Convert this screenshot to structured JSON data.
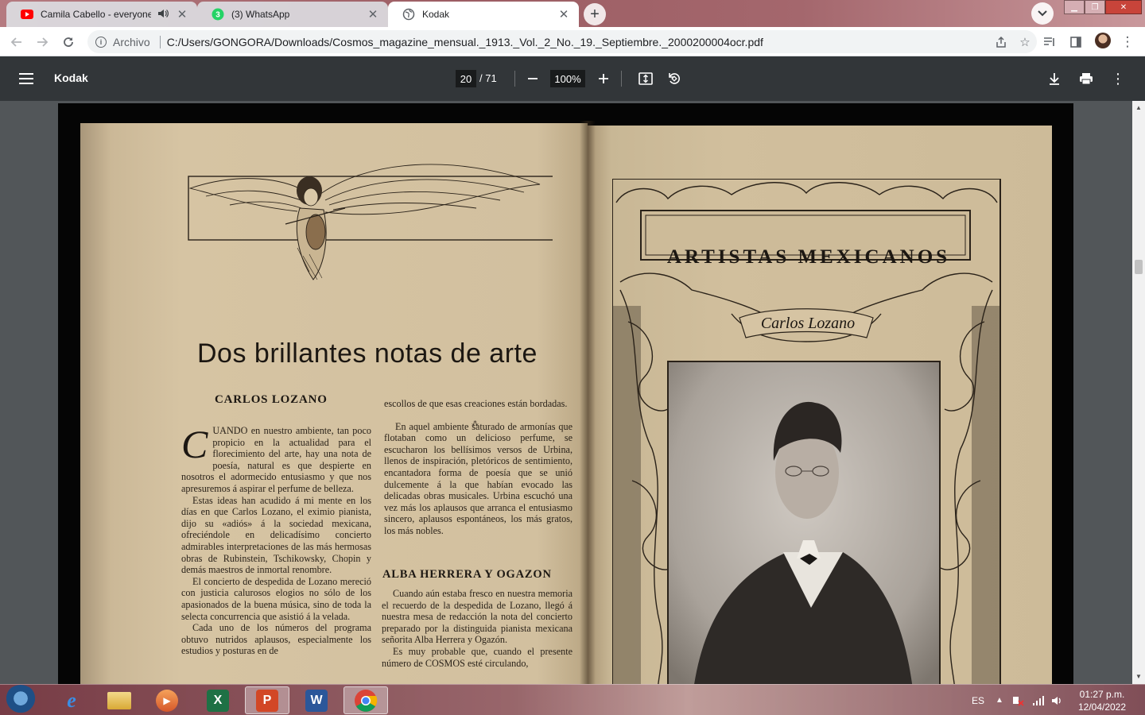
{
  "browser": {
    "tabs": [
      {
        "title": "Camila Cabello - everyone at",
        "favicon": "youtube-icon",
        "audio": true
      },
      {
        "title": "(3) WhatsApp",
        "favicon": "whatsapp-icon",
        "badge": "3"
      },
      {
        "title": "Kodak",
        "favicon": "globe-icon",
        "active": true
      }
    ],
    "scheme_label": "Archivo",
    "url": "C:/Users/GONGORA/Downloads/Cosmos_magazine_mensual._1913._Vol._2_No._19._Septiembre._2000200004ocr.pdf"
  },
  "pdf": {
    "title": "Kodak",
    "page_current": "20",
    "page_total": "/ 71",
    "zoom": "100%"
  },
  "magazine": {
    "left_title": "Dos brillantes notas de arte",
    "heading1": "CARLOS LOZANO",
    "dropcap": "C",
    "col1_p1": "UANDO en nuestro ambiente, tan poco propicio en la actualidad para el florecimiento del arte, hay una nota de poesía, natural es que despierte en nosotros el adormecido entusiasmo y que nos apresuremos á aspirar el perfume de belleza.",
    "col1_p2": "Estas ideas han acudido á mi mente en los días en que Carlos Lozano, el eximio pianista, dijo su «adiós» á la sociedad mexicana, ofreciéndole en delicadísimo concierto admirables interpretaciones de las más hermosas obras de Rubinstein, Tschikowsky, Chopin y demás maestros de inmortal renombre.",
    "col1_p3": "El concierto de despedida de Lozano mereció con justicia calurosos elogios no sólo de los apasionados de la buena música, sino de toda la selecta concurrencia que asistió á la velada.",
    "col1_p4": "Cada uno de los números del programa obtuvo nutridos aplausos, especialmente los estudios y posturas en de",
    "col2_p1": "escollos de que esas creaciones están bordadas.",
    "col2_p2": "En aquel ambiente saturado de armonías que flotaban como un delicioso perfume, se escucharon los bellísimos versos de Urbina, llenos de inspiración, pletóricos de sentimiento, encantadora forma de poesía que se unió dulcemente á la que habían evocado las delicadas obras musicales. Urbina escuchó una vez más los aplausos que arranca el entusiasmo sincero, aplausos espontáneos, los más gratos, los más nobles.",
    "heading2": "ALBA HERRERA Y OGAZON",
    "col2_p3": "Cuando aún estaba fresco en nuestra memoria el recuerdo de la despedida de Lozano, llegó á nuestra mesa de redacción la nota del concierto preparado por la distinguida pianista mexicana señorita Alba Herrera y Ogazón.",
    "col2_p4": "Es muy probable que, cuando el presente número de COSMOS esté circulando,",
    "right_banner": "ARTISTAS MEXICANOS",
    "right_ribbon": "Carlos Lozano"
  },
  "taskbar": {
    "apps": [
      "internet-explorer-icon",
      "file-explorer-icon",
      "media-player-icon",
      "excel-icon",
      "powerpoint-icon",
      "word-icon",
      "chrome-icon"
    ],
    "lang": "ES",
    "time": "01:27 p.m.",
    "date": "12/04/2022"
  },
  "colors": {
    "pdf_toolbar": "#323639",
    "viewer_bg": "#525659",
    "paper": "#d2c09f"
  }
}
